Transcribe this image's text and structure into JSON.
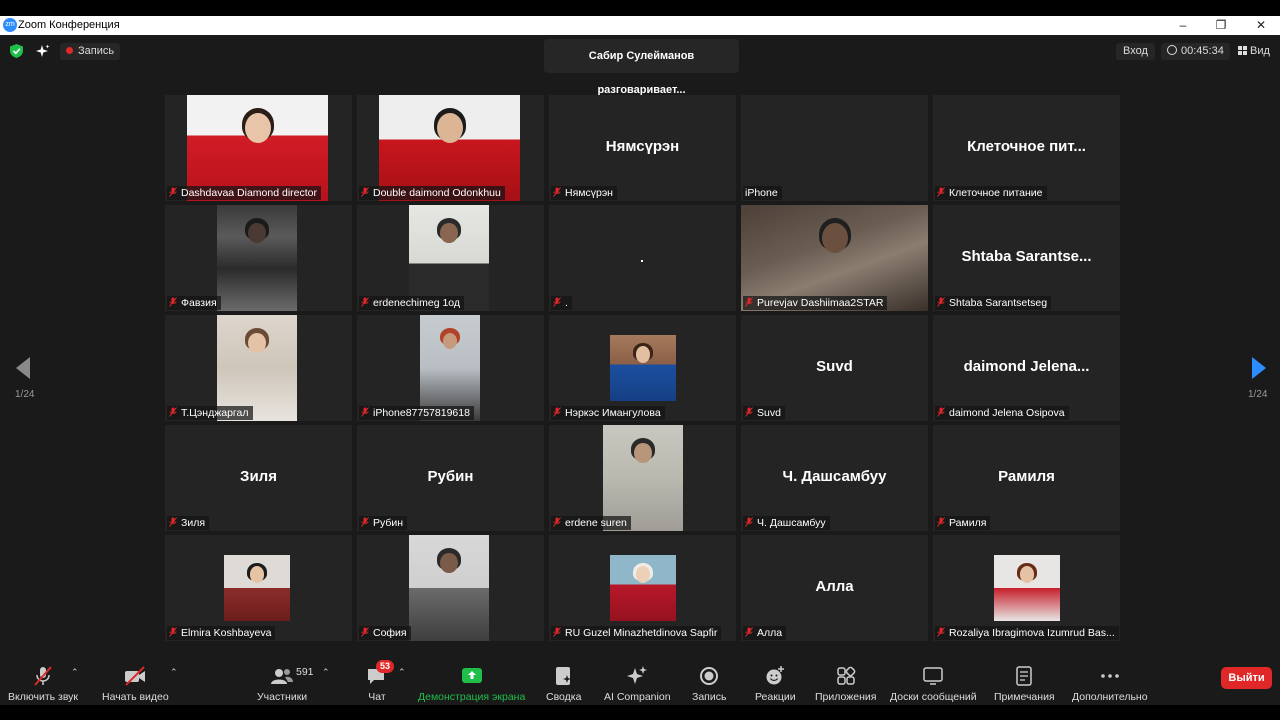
{
  "window": {
    "title": "Zoom Конференция",
    "logo": "zm"
  },
  "topbar": {
    "record_label": "Запись",
    "speaking": "Сабир Сулейманов разговаривает...",
    "entry_label": "Вход",
    "timer": "00:45:34",
    "view_label": "Вид"
  },
  "pagination": {
    "left": "1/24",
    "right": "1/24"
  },
  "tiles": [
    {
      "name": "Dashdavaa Diamond director",
      "big": "",
      "video": "red-suit-woman"
    },
    {
      "name": "Double daimond Odonkhuu",
      "big": "",
      "video": "couple-red"
    },
    {
      "name": "Нямсүрэн",
      "big": "Нямсүрэн",
      "video": ""
    },
    {
      "name": "iPhone",
      "big": "",
      "video": ""
    },
    {
      "name": "Клеточное питание",
      "big": "Клеточное пит...",
      "video": ""
    },
    {
      "name": "Фавзия",
      "big": "",
      "video": "dark-room"
    },
    {
      "name": "erdenechimeg 1од",
      "big": "",
      "video": "man-light"
    },
    {
      "name": ".",
      "big": "",
      "video": ""
    },
    {
      "name": "Purevjav Dashiimaa2STAR",
      "big": "",
      "video": "room-wide"
    },
    {
      "name": "Shtaba Sarantsetseg",
      "big": "Shtaba  Sarantse...",
      "video": ""
    },
    {
      "name": "Т.Цэнджаргал",
      "big": "",
      "video": "woman-light"
    },
    {
      "name": "iPhone87757819618",
      "big": "",
      "video": "woman-red-hair"
    },
    {
      "name": "Нэркэс Имангулова",
      "big": "",
      "video": "woman-blue-dress"
    },
    {
      "name": "Suvd",
      "big": "Suvd",
      "video": ""
    },
    {
      "name": "daimond Jelena Osipova",
      "big": "daimond  Jelena...",
      "video": ""
    },
    {
      "name": "Зиля",
      "big": "Зиля",
      "video": ""
    },
    {
      "name": "Рубин",
      "big": "Рубин",
      "video": ""
    },
    {
      "name": "erdene suren",
      "big": "",
      "video": "woman-paper"
    },
    {
      "name": "Ч. Дашсамбуу",
      "big": "Ч. Дашсамбуу",
      "video": ""
    },
    {
      "name": "Рамиля",
      "big": "Рамиля",
      "video": ""
    },
    {
      "name": "Elmira Koshbayeva",
      "big": "",
      "video": "woman-floral"
    },
    {
      "name": "София",
      "big": "",
      "video": "woman-window"
    },
    {
      "name": "RU Guzel Minazhetdinova Sapfir",
      "big": "",
      "video": "woman-hijab"
    },
    {
      "name": "Алла",
      "big": "Алла",
      "video": ""
    },
    {
      "name": "Rozaliya  Ibragimova Izumrud  Bas...",
      "big": "",
      "video": "woman-red-scarf"
    }
  ],
  "toolbar": {
    "unmute": "Включить звук",
    "start_video": "Начать видео",
    "participants": "Участники",
    "participants_count": "591",
    "chat": "Чат",
    "chat_badge": "53",
    "share": "Демонстрация экрана",
    "summary": "Сводка",
    "ai": "AI Companion",
    "record": "Запись",
    "reactions": "Реакции",
    "apps": "Приложения",
    "whiteboards": "Доски сообщений",
    "notes": "Примечания",
    "more": "Дополнительно",
    "leave": "Выйти"
  },
  "colors": {
    "accent_green": "#1fbf4a",
    "leave_red": "#e02828",
    "arrow_blue": "#2d8cff",
    "mic_red": "#e02828"
  }
}
